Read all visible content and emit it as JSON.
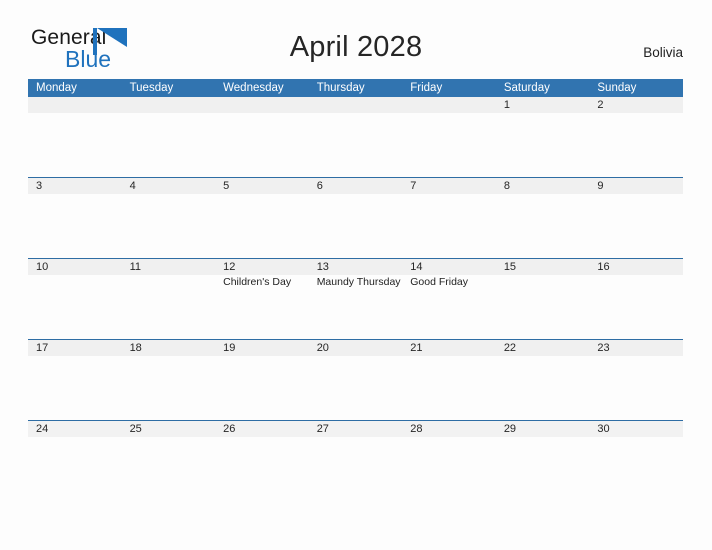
{
  "brand": {
    "word_one": "General",
    "word_two": "Blue",
    "flag_icon": "blue-triangle-flag-icon",
    "accent_color": "#1f72bd"
  },
  "header": {
    "title": "April 2028",
    "country": "Bolivia"
  },
  "colors": {
    "header_bar": "#3174b0",
    "row_rule": "#2e6da4",
    "daynum_band": "#f0f0f0",
    "page_background": "#fdfdfd",
    "brand_blue": "#1f72bd"
  },
  "calendar": {
    "month": "April",
    "year": "2028",
    "week_start": "Monday",
    "weekdays": [
      {
        "label": "Monday"
      },
      {
        "label": "Tuesday"
      },
      {
        "label": "Wednesday"
      },
      {
        "label": "Thursday"
      },
      {
        "label": "Friday"
      },
      {
        "label": "Saturday"
      },
      {
        "label": "Sunday"
      }
    ],
    "weeks": [
      [
        {
          "day": "",
          "events": []
        },
        {
          "day": "",
          "events": []
        },
        {
          "day": "",
          "events": []
        },
        {
          "day": "",
          "events": []
        },
        {
          "day": "",
          "events": []
        },
        {
          "day": "1",
          "events": []
        },
        {
          "day": "2",
          "events": []
        }
      ],
      [
        {
          "day": "3",
          "events": []
        },
        {
          "day": "4",
          "events": []
        },
        {
          "day": "5",
          "events": []
        },
        {
          "day": "6",
          "events": []
        },
        {
          "day": "7",
          "events": []
        },
        {
          "day": "8",
          "events": []
        },
        {
          "day": "9",
          "events": []
        }
      ],
      [
        {
          "day": "10",
          "events": []
        },
        {
          "day": "11",
          "events": []
        },
        {
          "day": "12",
          "events": [
            "Children's Day"
          ]
        },
        {
          "day": "13",
          "events": [
            "Maundy Thursday"
          ]
        },
        {
          "day": "14",
          "events": [
            "Good Friday"
          ]
        },
        {
          "day": "15",
          "events": []
        },
        {
          "day": "16",
          "events": []
        }
      ],
      [
        {
          "day": "17",
          "events": []
        },
        {
          "day": "18",
          "events": []
        },
        {
          "day": "19",
          "events": []
        },
        {
          "day": "20",
          "events": []
        },
        {
          "day": "21",
          "events": []
        },
        {
          "day": "22",
          "events": []
        },
        {
          "day": "23",
          "events": []
        }
      ],
      [
        {
          "day": "24",
          "events": []
        },
        {
          "day": "25",
          "events": []
        },
        {
          "day": "26",
          "events": []
        },
        {
          "day": "27",
          "events": []
        },
        {
          "day": "28",
          "events": []
        },
        {
          "day": "29",
          "events": []
        },
        {
          "day": "30",
          "events": []
        }
      ]
    ]
  }
}
